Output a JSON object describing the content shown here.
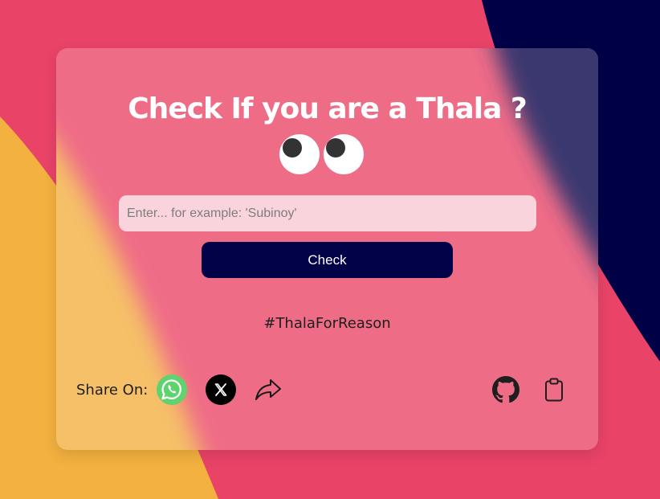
{
  "colors": {
    "background_pink": "#e94368",
    "background_navy": "#000047",
    "background_yellow": "#f3b13f",
    "card_glass": "#ef6c87",
    "input_background": "#fad4dd",
    "button_background": "#020249",
    "whatsapp_green": "#5fd36e"
  },
  "card": {
    "title": "Check If you are a Thala ?",
    "eyes_icon": "eyes-emoji",
    "input": {
      "placeholder": "Enter... for example: 'Subinoy'",
      "value": ""
    },
    "check_button_label": "Check",
    "hashtag": "#ThalaForReason",
    "share": {
      "label": "Share On:",
      "icons": [
        "whatsapp-icon",
        "x-icon",
        "share-arrow-icon"
      ]
    },
    "right_icons": [
      "github-icon",
      "clipboard-icon"
    ]
  }
}
